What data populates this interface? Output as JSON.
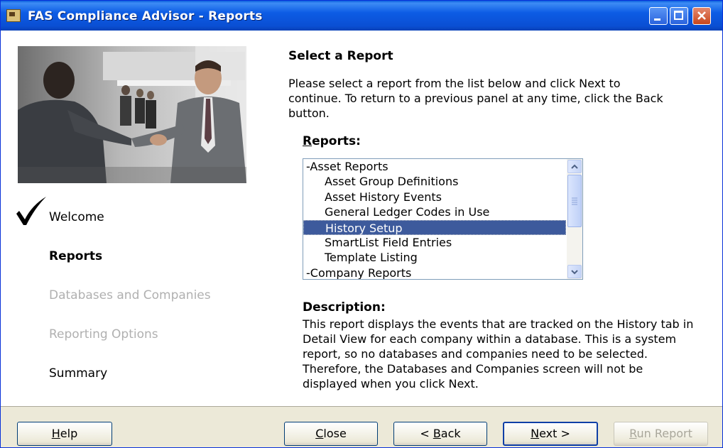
{
  "window": {
    "title": "FAS Compliance Advisor - Reports"
  },
  "sidebar": {
    "steps": [
      {
        "label": "Welcome",
        "state": "completed"
      },
      {
        "label": "Reports",
        "state": "current"
      },
      {
        "label": "Databases and Companies",
        "state": "disabled"
      },
      {
        "label": "Reporting Options",
        "state": "disabled"
      },
      {
        "label": "Summary",
        "state": "pending"
      }
    ]
  },
  "main": {
    "title": "Select a Report",
    "intro": "Please select a report from the list below and click Next to continue. To return to a previous panel at any time, click the Back button.",
    "reports_label_accel": "R",
    "reports_label_rest": "eports:",
    "reports": [
      {
        "label": "-Asset Reports",
        "level": 0
      },
      {
        "label": "Asset Group Definitions",
        "level": 1
      },
      {
        "label": "Asset History Events",
        "level": 1
      },
      {
        "label": "General Ledger Codes in Use",
        "level": 1
      },
      {
        "label": "History Setup",
        "level": 1,
        "selected": true
      },
      {
        "label": "SmartList Field Entries",
        "level": 1
      },
      {
        "label": "Template Listing",
        "level": 1
      },
      {
        "label": "-Company Reports",
        "level": 0
      }
    ],
    "description_label": "Description:",
    "description": "This report displays the events that are tracked on the History tab in Detail View for each company within a database. This is a system report, so no databases and companies need to be selected.  Therefore, the Databases and Companies screen will not be displayed when you click Next."
  },
  "buttons": {
    "help": {
      "accel": "H",
      "rest": "elp"
    },
    "close": {
      "accel": "C",
      "rest": "lose"
    },
    "back": {
      "prefix": "< ",
      "accel": "B",
      "rest": "ack"
    },
    "next": {
      "accel": "N",
      "rest": "ext >"
    },
    "run_report": {
      "accel": "R",
      "rest": "un Report",
      "enabled": false
    }
  },
  "colors": {
    "titlebar": "#0a4fd3",
    "selection": "#3d5a9c",
    "disabled_text": "#b0b0b0",
    "button_face": "#ece9d8"
  }
}
